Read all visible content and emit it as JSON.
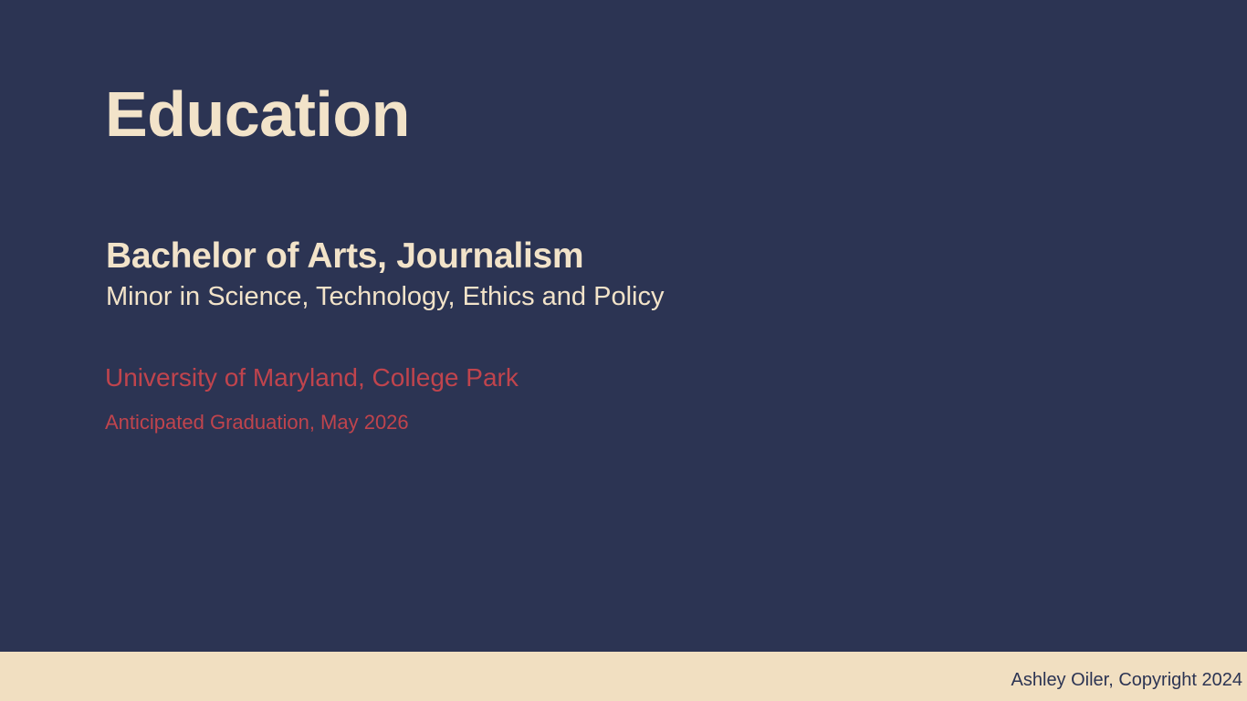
{
  "slide": {
    "title": "Education",
    "degree": "Bachelor of Arts, Journalism",
    "minor": "Minor in Science, Technology, Ethics and Policy",
    "university": "University of Maryland, College Park",
    "graduation": "Anticipated Graduation, May 2026"
  },
  "footer": {
    "copyright": "Ashley Oiler, Copyright 2024"
  },
  "colors": {
    "background": "#2c3453",
    "heading_text": "#f2e3c9",
    "accent_text": "#c0444d",
    "footer_bar": "#f1dfc1"
  }
}
